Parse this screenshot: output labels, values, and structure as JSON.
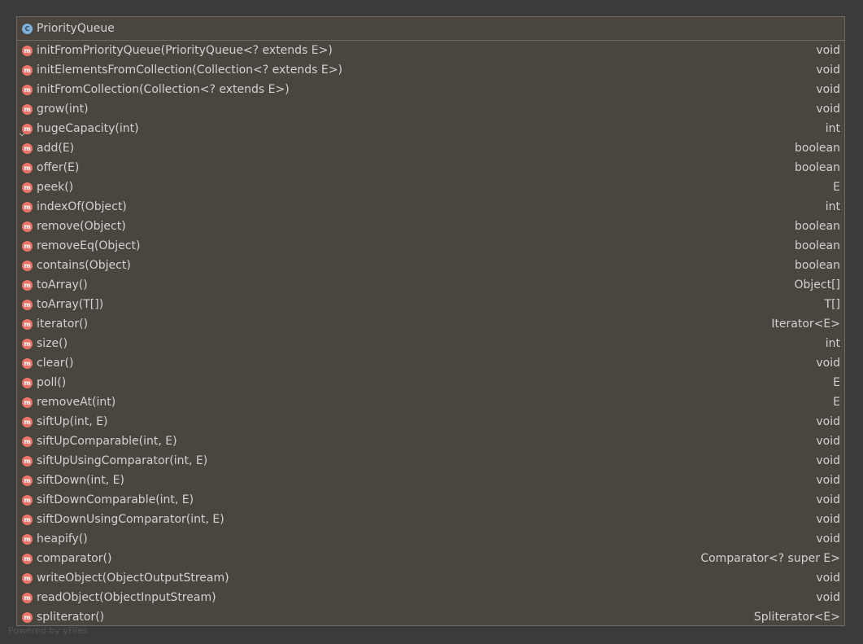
{
  "class": {
    "name": "PriorityQueue",
    "icon": "C"
  },
  "methods": [
    {
      "name": "initFromPriorityQueue(PriorityQueue<? extends E>)",
      "type": "void",
      "mark": ""
    },
    {
      "name": "initElementsFromCollection(Collection<? extends E>)",
      "type": "void",
      "mark": ""
    },
    {
      "name": "initFromCollection(Collection<? extends E>)",
      "type": "void",
      "mark": ""
    },
    {
      "name": "grow(int)",
      "type": "void",
      "mark": ""
    },
    {
      "name": "hugeCapacity(int)",
      "type": "int",
      "mark": "⌵"
    },
    {
      "name": "add(E)",
      "type": "boolean",
      "mark": ""
    },
    {
      "name": "offer(E)",
      "type": "boolean",
      "mark": ""
    },
    {
      "name": "peek()",
      "type": "E",
      "mark": ""
    },
    {
      "name": "indexOf(Object)",
      "type": "int",
      "mark": ""
    },
    {
      "name": "remove(Object)",
      "type": "boolean",
      "mark": ""
    },
    {
      "name": "removeEq(Object)",
      "type": "boolean",
      "mark": ""
    },
    {
      "name": "contains(Object)",
      "type": "boolean",
      "mark": ""
    },
    {
      "name": "toArray()",
      "type": "Object[]",
      "mark": ""
    },
    {
      "name": "toArray(T[])",
      "type": "T[]",
      "mark": ""
    },
    {
      "name": "iterator()",
      "type": "Iterator<E>",
      "mark": ""
    },
    {
      "name": "size()",
      "type": "int",
      "mark": ""
    },
    {
      "name": "clear()",
      "type": "void",
      "mark": ""
    },
    {
      "name": "poll()",
      "type": "E",
      "mark": ""
    },
    {
      "name": "removeAt(int)",
      "type": "E",
      "mark": ""
    },
    {
      "name": "siftUp(int, E)",
      "type": "void",
      "mark": ""
    },
    {
      "name": "siftUpComparable(int, E)",
      "type": "void",
      "mark": ""
    },
    {
      "name": "siftUpUsingComparator(int, E)",
      "type": "void",
      "mark": ""
    },
    {
      "name": "siftDown(int, E)",
      "type": "void",
      "mark": ""
    },
    {
      "name": "siftDownComparable(int, E)",
      "type": "void",
      "mark": ""
    },
    {
      "name": "siftDownUsingComparator(int, E)",
      "type": "void",
      "mark": ""
    },
    {
      "name": "heapify()",
      "type": "void",
      "mark": ""
    },
    {
      "name": "comparator()",
      "type": "Comparator<? super E>",
      "mark": ""
    },
    {
      "name": "writeObject(ObjectOutputStream)",
      "type": "void",
      "mark": ""
    },
    {
      "name": "readObject(ObjectInputStream)",
      "type": "void",
      "mark": ""
    },
    {
      "name": "spliterator()",
      "type": "Spliterator<E>",
      "mark": ""
    }
  ],
  "method_icon": "m",
  "colors": {
    "background": "#3b3b3b",
    "box_fill": "#4a463f",
    "method_icon": "#e8756a",
    "class_icon": "#7fb0d8",
    "text": "#d2d2d2"
  },
  "watermark": "Powered by yFiles"
}
